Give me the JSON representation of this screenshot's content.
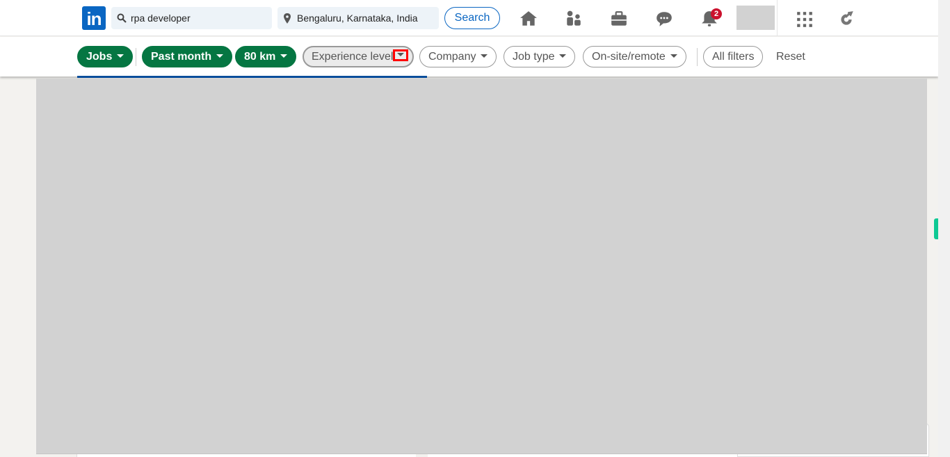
{
  "header": {
    "logo_text": "in",
    "search_value": "rpa developer",
    "location_value": "Bengaluru, Karnataka, India",
    "search_button": "Search",
    "nav_icons": [
      "home-icon",
      "my-network-icon",
      "jobs-icon",
      "messaging-icon",
      "notifications-icon",
      "avatar",
      "apps-grid-icon",
      "premium-icon"
    ],
    "notification_count": "2"
  },
  "filters": {
    "items": [
      {
        "label": "Jobs",
        "active": true
      },
      {
        "label": "Past month",
        "active": true
      },
      {
        "label": "80 km",
        "active": true
      },
      {
        "label": "Experience level",
        "active": false,
        "focused": true
      },
      {
        "label": "Company",
        "active": false
      },
      {
        "label": "Job type",
        "active": false
      },
      {
        "label": "On-site/remote",
        "active": false
      }
    ],
    "all_filters": "All filters",
    "reset": "Reset"
  },
  "colors": {
    "brand": "#0a66c2",
    "active_filter": "#057642",
    "highlight": "#ff0000",
    "badge": "#cb112d"
  }
}
